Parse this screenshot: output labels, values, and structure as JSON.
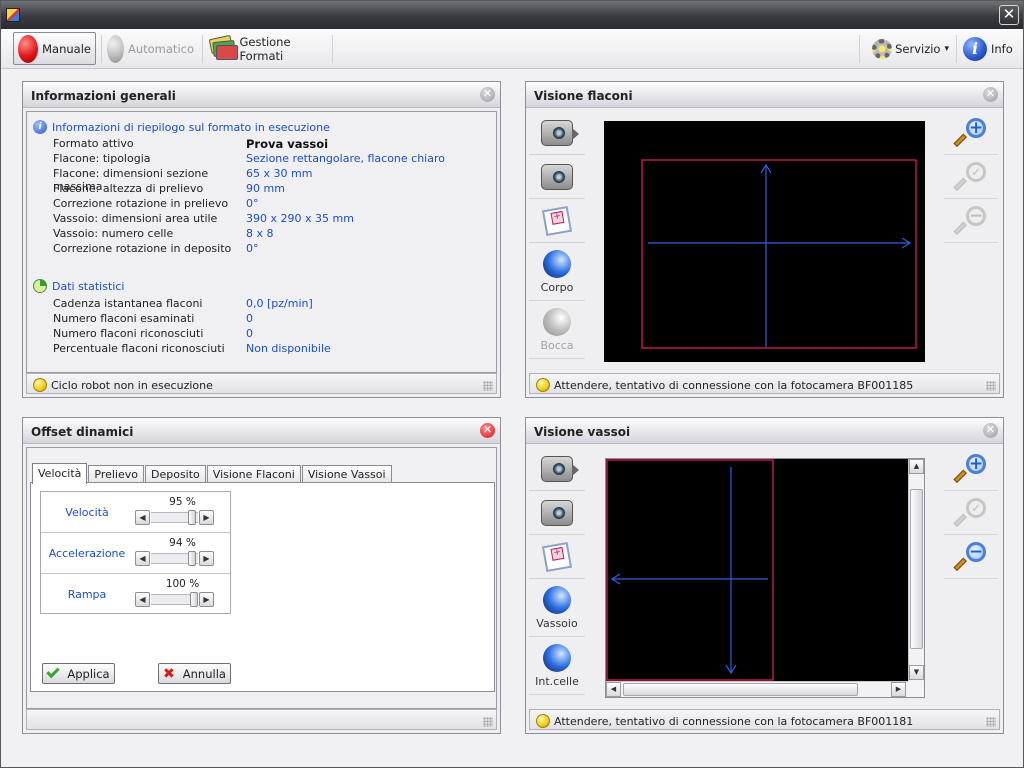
{
  "titlebar": {
    "close_glyph": "✕"
  },
  "toolbar": {
    "manuale": "Manuale",
    "automatico": "Automatico",
    "gestione_formati": "Gestione Formati",
    "servizio": "Servizio",
    "servizio_arrow": "▾",
    "info": "Info",
    "info_glyph": "i"
  },
  "info_panel": {
    "title": "Informazioni generali",
    "section1": "Informazioni di riepilogo sul formato in esecuzione",
    "rows": [
      {
        "label": "Formato attivo",
        "value": "Prova vassoi"
      },
      {
        "label": "Flacone: tipologia",
        "value": "Sezione rettangolare, flacone chiaro"
      },
      {
        "label": "Flacone: dimensioni sezione massima",
        "value": "65 x 30 mm"
      },
      {
        "label": "Flacone: altezza di prelievo",
        "value": "90 mm"
      },
      {
        "label": "Correzione rotazione in prelievo",
        "value": "0°"
      },
      {
        "label": "Vassoio: dimensioni area utile",
        "value": "390 x 290 x 35 mm"
      },
      {
        "label": "Vassoio: numero celle",
        "value": "8 x 8"
      },
      {
        "label": "Correzione rotazione in deposito",
        "value": "0°"
      }
    ],
    "section2": "Dati statistici",
    "stats": [
      {
        "label": "Cadenza istantanea flaconi",
        "value": "0,0 [pz/min]"
      },
      {
        "label": "Numero flaconi esaminati",
        "value": "0"
      },
      {
        "label": "Numero flaconi riconosciuti",
        "value": "0"
      },
      {
        "label": "Percentuale flaconi riconosciuti",
        "value": "Non disponibile"
      }
    ],
    "status": "Ciclo robot non in esecuzione"
  },
  "flaconi_panel": {
    "title": "Visione flaconi",
    "corpo": "Corpo",
    "bocca": "Bocca",
    "status": "Attendere, tentativo di connessione con la fotocamera BF001185"
  },
  "offset_panel": {
    "title": "Offset dinamici",
    "tabs": [
      "Velocità",
      "Prelievo",
      "Deposito",
      "Visione Flaconi",
      "Visione Vassoi"
    ],
    "rows": [
      {
        "label": "Velocità",
        "value": "95 %",
        "level": 0.95
      },
      {
        "label": "Accelerazione",
        "value": "94 %",
        "level": 0.94
      },
      {
        "label": "Rampa",
        "value": "100 %",
        "level": 1.0
      }
    ],
    "applica": "Applica",
    "annulla": "Annulla"
  },
  "vassoi_panel": {
    "title": "Visione vassoi",
    "vassoio": "Vassoio",
    "intcelle": "Int.celle",
    "status": "Attendere, tentativo di connessione con la fotocamera BF001181"
  },
  "colors": {
    "accent": "#1b4fc4",
    "overlay_rect": "#d0205a",
    "overlay_axes": "#2f5fe0",
    "manual_red": "#e01818"
  }
}
